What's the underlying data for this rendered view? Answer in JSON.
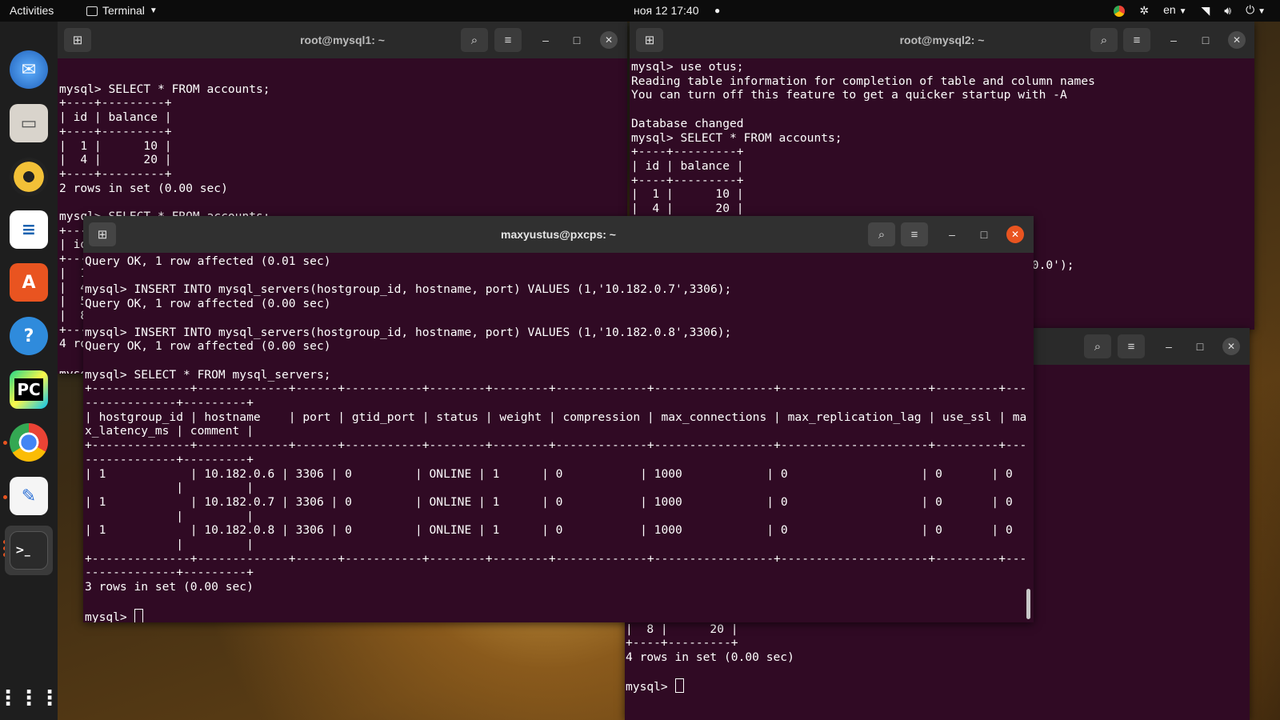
{
  "topbar": {
    "activities": "Activities",
    "app_name": "Terminal",
    "clock": "ноя 12  17:40",
    "lang": "en"
  },
  "dock": {
    "items": [
      "thunderbird-icon",
      "files-icon",
      "rhythmbox-icon",
      "writer-icon",
      "software-icon",
      "help-icon",
      "pycharm-icon",
      "chrome-icon",
      "text-editor-icon",
      "terminal-icon"
    ]
  },
  "windows": {
    "mysql1": {
      "title": "root@mysql1: ~",
      "lines": [
        "",
        "mysql> SELECT * FROM accounts;",
        "+----+---------+",
        "| id | balance |",
        "+----+---------+",
        "|  1 |      10 |",
        "|  4 |      20 |",
        "+----+---------+",
        "2 rows in set (0.00 sec)",
        "",
        "mysql> SELECT * FROM accounts;",
        "+----+---------+",
        "| id | balance |",
        "+----+---------+",
        "|  1 |      10 |",
        "|  4 |      20 |",
        "|  5 |      10 |",
        "|  8 |      20 |",
        "+----+---------+",
        "4 rows in set (0.00 sec)",
        "",
        "mysql> "
      ]
    },
    "mysql2": {
      "title": "root@mysql2: ~",
      "lines": [
        "mysql> use otus;",
        "Reading table information for completion of table and column names",
        "You can turn off this feature to get a quicker startup with -A",
        "",
        "Database changed",
        "mysql> SELECT * FROM accounts;",
        "+----+---------+",
        "| id | balance |",
        "+----+---------+",
        "|  1 |      10 |",
        "|  4 |      20 |",
        "+----+---------+",
        "",
        "",
        "                                                         0.0');"
      ]
    },
    "mysql3": {
      "lines": [
        "   h -A",
        "",
        "",
        "",
        "",
        "",
        "",
        "",
        "",
        "",
        "",
        "",
        "",
        "",
        "",
        "",
        "",
        "|  5 |      10 |",
        "|  8 |      20 |",
        "+----+---------+",
        "4 rows in set (0.00 sec)",
        "",
        "mysql> "
      ]
    },
    "main": {
      "title": "maxyustus@pxcps: ~",
      "lines": [
        "Query OK, 1 row affected (0.01 sec)",
        "",
        "mysql> INSERT INTO mysql_servers(hostgroup_id, hostname, port) VALUES (1,'10.182.0.7',3306);",
        "Query OK, 1 row affected (0.00 sec)",
        "",
        "mysql> INSERT INTO mysql_servers(hostgroup_id, hostname, port) VALUES (1,'10.182.0.8',3306);",
        "Query OK, 1 row affected (0.00 sec)",
        "",
        "mysql> SELECT * FROM mysql_servers;",
        "+--------------+-------------+------+-----------+--------+--------+-------------+-----------------+---------------------+---------+---",
        "-------------+---------+",
        "| hostgroup_id | hostname    | port | gtid_port | status | weight | compression | max_connections | max_replication_lag | use_ssl | ma",
        "x_latency_ms | comment |",
        "+--------------+-------------+------+-----------+--------+--------+-------------+-----------------+---------------------+---------+---",
        "-------------+---------+",
        "| 1            | 10.182.0.6 | 3306 | 0         | ONLINE | 1      | 0           | 1000            | 0                   | 0       | 0",
        "             |         |",
        "| 1            | 10.182.0.7 | 3306 | 0         | ONLINE | 1      | 0           | 1000            | 0                   | 0       | 0",
        "             |         |",
        "| 1            | 10.182.0.8 | 3306 | 0         | ONLINE | 1      | 0           | 1000            | 0                   | 0       | 0",
        "             |         |",
        "+--------------+-------------+------+-----------+--------+--------+-------------+-----------------+---------------------+---------+---",
        "-------------+---------+",
        "3 rows in set (0.00 sec)",
        "",
        "mysql> "
      ]
    }
  },
  "colors": {
    "terminal_bg": "#300a24",
    "accent": "#e95420",
    "titlebar": "#2c2c2c"
  }
}
